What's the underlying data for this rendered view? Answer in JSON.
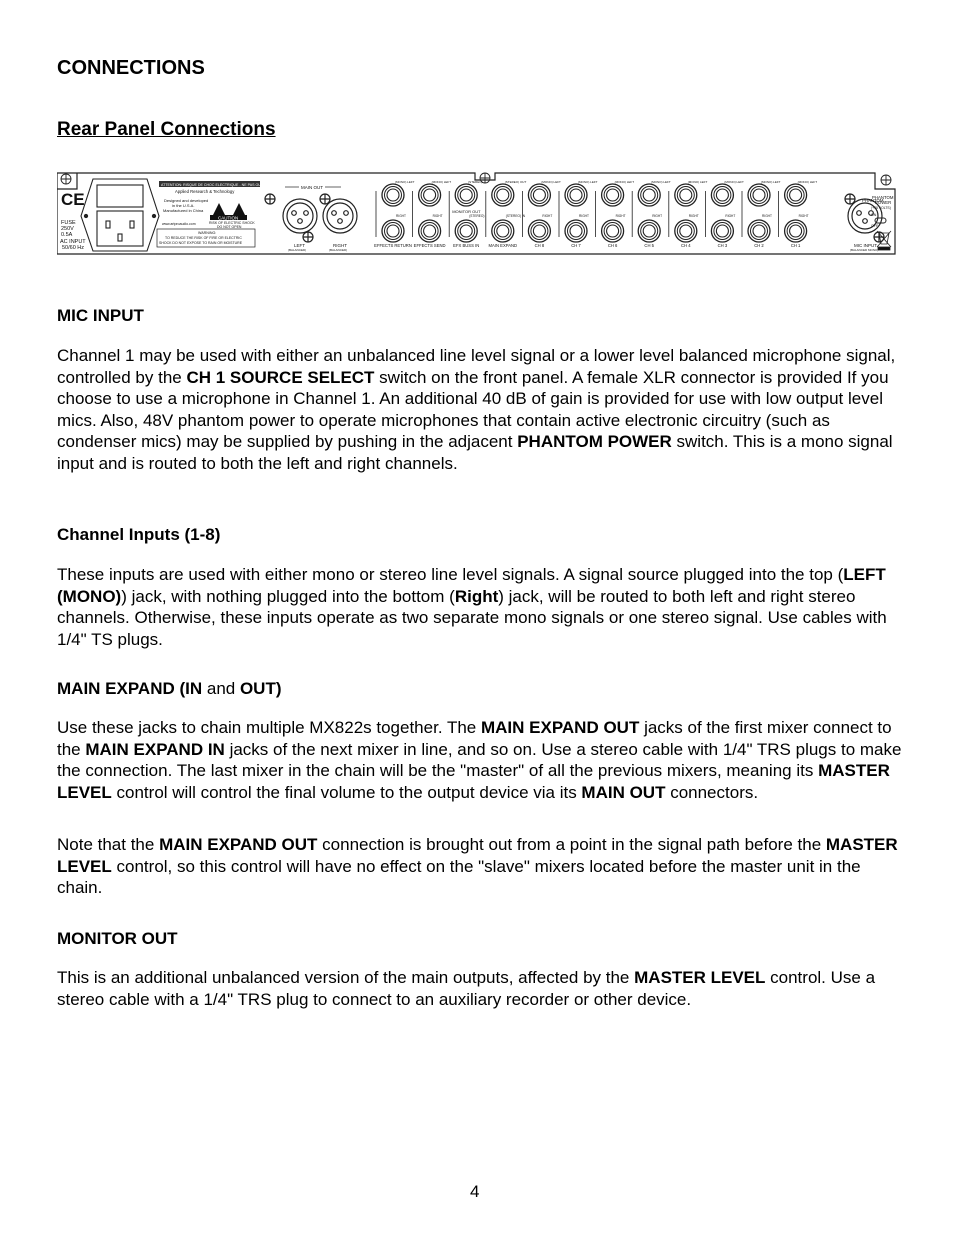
{
  "title": "CONNECTIONS",
  "subtitle": "Rear Panel Connections",
  "panel": {
    "top_label": "ATTENTION: RISQUE DE CHOC ELECTRIQUE - NE PAS OUVRIR",
    "brand": "Applied Research & Technology",
    "origin": [
      "Designed and developed",
      "in the U.S.A.",
      "Manufactured in China"
    ],
    "website": "www.artproaudio.com",
    "caution": "CAUTION",
    "caution_sub": [
      "RISK OF ELECTRIC SHOCK",
      "DO NOT OPEN"
    ],
    "warning_title": "WARNING:",
    "warning_lines": [
      "TO REDUCE THE RISK OF FIRE OR ELECTRIC",
      "SHOCK DO NOT EXPOSE TO RAIN OR MOISTURE"
    ],
    "ce": "CE",
    "fuse": [
      "FUSE",
      "250V",
      "0.5A"
    ],
    "ac_input": [
      "AC INPUT",
      "50/60 Hz"
    ],
    "main_out": "MAIN OUT",
    "xlr_left": "LEFT",
    "xlr_right": "RIGHT",
    "balanced": "(BALANCED)",
    "jack_groups": [
      {
        "label": "EFFECTS RETURN",
        "top": "(MONO) LEFT",
        "bottom": "RIGHT"
      },
      {
        "label": "EFFECTS SEND",
        "top": "(MONO) LEFT",
        "bottom": "RIGHT"
      },
      {
        "label": "EFX BUSS IN",
        "top": "(STEREO)",
        "bottom": "(STEREO)",
        "middle": "MONITOR OUT"
      },
      {
        "label": "MAIN EXPAND",
        "top": "(STEREO) OUT",
        "bottom": "(STEREO) IN"
      },
      {
        "label": "CH 8",
        "top": "(MONO) LEFT",
        "bottom": "RIGHT"
      },
      {
        "label": "CH 7",
        "top": "(MONO) LEFT",
        "bottom": "RIGHT"
      },
      {
        "label": "CH 6",
        "top": "(MONO) LEFT",
        "bottom": "RIGHT"
      },
      {
        "label": "CH 5",
        "top": "(MONO) LEFT",
        "bottom": "RIGHT"
      },
      {
        "label": "CH 4",
        "top": "(MONO) LEFT",
        "bottom": "RIGHT"
      },
      {
        "label": "CH 3",
        "top": "(MONO) LEFT",
        "bottom": "RIGHT"
      },
      {
        "label": "CH 2",
        "top": "(MONO) LEFT",
        "bottom": "RIGHT"
      },
      {
        "label": "CH 1",
        "top": "(MONO) LEFT",
        "bottom": "RIGHT"
      }
    ],
    "mic_input": "MIC INPUT",
    "mic_input_sub": "(BALANCED MONO)",
    "phantom": [
      "PHANTOM",
      "POWER",
      "(+48 VOLTS)"
    ],
    "phantom_on": "ON",
    "phantom_off": "OFF"
  },
  "sections": {
    "mic_input": {
      "heading": "MIC INPUT",
      "p1": [
        {
          "t": "Channel 1 may be used with either an unbalanced line level signal or a lower level balanced microphone signal, controlled by the "
        },
        {
          "b": "CH 1 SOURCE SELECT"
        },
        {
          "t": " switch on the front panel. A female XLR connector is provided If you choose to use a microphone in Channel 1. An additional 40 dB of gain is provided for use with low output level mics. Also, 48V phantom power to operate microphones that contain active electronic circuitry (such as condenser mics) may be supplied by pushing in the adjacent "
        },
        {
          "b": "PHANTOM POWER"
        },
        {
          "t": " switch. This is a mono signal input and is routed to both the left and right channels."
        }
      ]
    },
    "channel_inputs": {
      "heading": "Channel Inputs (1-8)",
      "p1": [
        {
          "t": "These inputs are used with either mono or stereo line level signals. A signal source plugged into the top ("
        },
        {
          "b": "LEFT (MONO)"
        },
        {
          "t": ") jack, with nothing plugged into the bottom ("
        },
        {
          "b": "Right"
        },
        {
          "t": ") jack, will be routed to both left and right stereo channels. Otherwise, these inputs operate as two separate mono signals or one stereo signal. Use cables with 1/4\" TS plugs."
        }
      ]
    },
    "main_expand": {
      "heading_parts": [
        {
          "b": "MAIN EXPAND (IN"
        },
        {
          "t": " and "
        },
        {
          "b": "OUT)"
        }
      ],
      "p1": [
        {
          "t": "Use these jacks to chain multiple MX822s together. The "
        },
        {
          "b": "MAIN EXPAND OUT"
        },
        {
          "t": " jacks of the first mixer connect to the "
        },
        {
          "b": "MAIN EXPAND IN"
        },
        {
          "t": " jacks of the next mixer in line, and so on. Use a stereo cable with 1/4\" TRS plugs to make the connection. The last mixer in the chain will be the \"master\" of all the previous mixers, meaning its "
        },
        {
          "b": "MASTER LEVEL"
        },
        {
          "t": " control will control the final volume to the output device via its "
        },
        {
          "b": "MAIN OUT"
        },
        {
          "t": " connectors."
        }
      ],
      "p2": [
        {
          "t": "Note that the "
        },
        {
          "b": "MAIN EXPAND OUT"
        },
        {
          "t": " connection is brought out from a point in the signal path before the "
        },
        {
          "b": "MASTER LEVEL"
        },
        {
          "t": " control, so this control will have no effect on the \"slave\" mixers located before the master unit in the chain."
        }
      ]
    },
    "monitor_out": {
      "heading": "MONITOR OUT",
      "p1": [
        {
          "t": "This is an additional unbalanced version of the main outputs, affected by the "
        },
        {
          "b": "MASTER LEVEL"
        },
        {
          "t": " control. Use a stereo cable with a 1/4\" TRS plug to connect to an auxiliary recorder or other device."
        }
      ]
    }
  },
  "page_number": "4"
}
